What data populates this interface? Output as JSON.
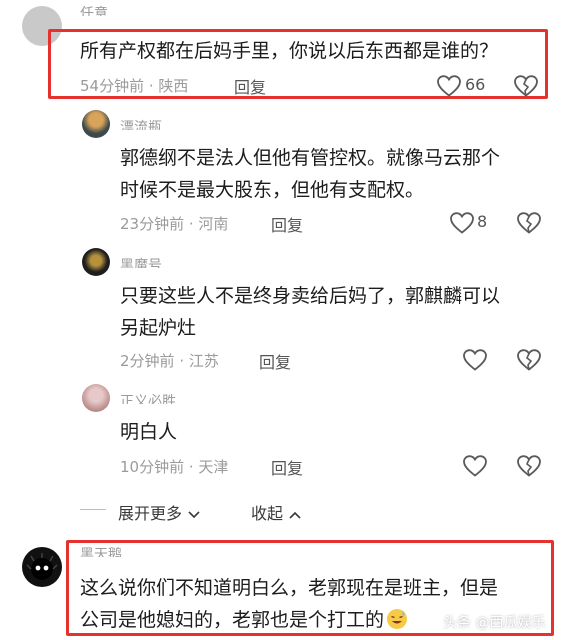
{
  "comments": [
    {
      "username": "任意",
      "text_lines": [
        "所有产权都在后妈手里，你说以后东西都是谁的？"
      ],
      "time": "54分钟前",
      "location": "陕西",
      "reply_label": "回复",
      "like_count": "66"
    },
    {
      "username": "漂流瓶",
      "text_lines": [
        "郭德纲不是法人但他有管控权。就像马云那个",
        "时候不是最大股东，但他有支配权。"
      ],
      "time": "23分钟前",
      "location": "河南",
      "reply_label": "回复",
      "like_count": "8"
    },
    {
      "username": "黑魔号",
      "text_lines": [
        "只要这些人不是终身卖给后妈了，郭麒麟可以",
        "另起炉灶"
      ],
      "time": "2分钟前",
      "location": "江苏",
      "reply_label": "回复",
      "like_count": ""
    },
    {
      "username": "正义必胜",
      "text_lines": [
        "明白人"
      ],
      "time": "10分钟前",
      "location": "天津",
      "reply_label": "回复",
      "like_count": ""
    },
    {
      "username": "黑天鹅",
      "text_lines": [
        "这么说你们不知道明白么，老郭现在是班主，但是",
        "公司是他媳妇的，老郭也是个打工的"
      ]
    }
  ],
  "expand_more": "展开更多",
  "collapse": "收起",
  "meta_separator": " · ",
  "watermark": "头条 @西瓜娱乐",
  "colors": {
    "highlight": "#e5322d",
    "meta": "#9b9b9b",
    "text": "#1c1c1c"
  }
}
